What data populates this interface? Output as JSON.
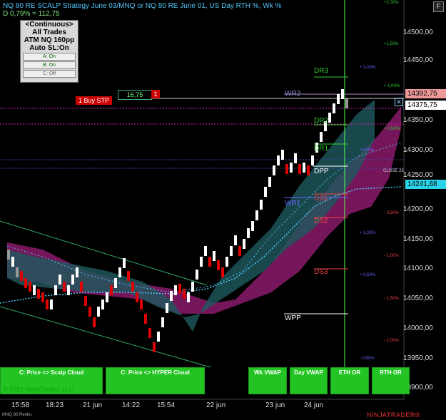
{
  "header": {
    "title": "NQ 80 RE SCALP Strategy June 03/MNQ or NQ 80 RE June 01, US Day RTH %, Wk %",
    "subtitle": "D 0,79% = 112,75"
  },
  "window": {
    "close_label": "F"
  },
  "atm_panel": {
    "line1": "<Continuous>",
    "line2": "All Trades",
    "line3": "ATM NQ 160pp",
    "line4": "Auto SL:On",
    "btn_a": "A: On",
    "btn_b": "B: On",
    "btn_c": "C: Off"
  },
  "price_axis": {
    "labels": [
      "14500,00",
      "14450,00",
      "14350,00",
      "14300,00",
      "14250,00",
      "14200,00",
      "14150,00",
      "14100,00",
      "14050,00",
      "14000,00",
      "13950,00",
      "13900,00"
    ],
    "tags": {
      "last_price": "14392,75",
      "current": "14375,75",
      "vwap": "14241,68"
    }
  },
  "time_axis": {
    "labels": [
      "15:58",
      "18:23",
      "21 jun",
      "14:22",
      "15:54",
      "22 jun",
      "23 jun",
      "24 jun"
    ]
  },
  "order": {
    "label": "1 Buy STP",
    "qty": "16,75",
    "count": "1",
    "close": "✕"
  },
  "levels": {
    "dr3": "DR3",
    "wr2": "WR2",
    "dr2": "DR2",
    "dr1": "DR1",
    "dpp": "DPP",
    "close": "CLOSE 23",
    "wr1": "WR1",
    "ds1": "DS1",
    "ds2": "DS2",
    "ds3": "DS3",
    "wpp": "WPP"
  },
  "pct_labels": {
    "p200": "+2,00%",
    "p150": "+1,50%",
    "p300": "+ 3,00%",
    "p100": "+ 1,00%",
    "p050": "+ 0,50%",
    "p200b": "+2,00%",
    "m050": "- 0,50%",
    "p100b": "+ 1,00%",
    "m100": "- 1,00%",
    "p050b": "+ 0,50%",
    "m150": "- 1,50%",
    "m200": "- 2,00%",
    "m050b": "- 0,50%"
  },
  "bottom_buttons": {
    "scalp": "C: Price <> Scalp Cloud",
    "hyper": "C: Price <> HYPER Cloud",
    "wkvwap": "Wk VWAP",
    "dayvwap": "Day VWAP",
    "ethor": "ETH OR",
    "rthor": "RTH OR"
  },
  "footer": {
    "copyright": "© 2021 NinjaTrader, LLC",
    "instrument": "MNQ 80 Renko",
    "brand": "NINJATRADER®"
  },
  "colors": {
    "up": "#ffffff",
    "down": "#e00000",
    "neutral": "#999999",
    "accent_green": "#22c322"
  }
}
